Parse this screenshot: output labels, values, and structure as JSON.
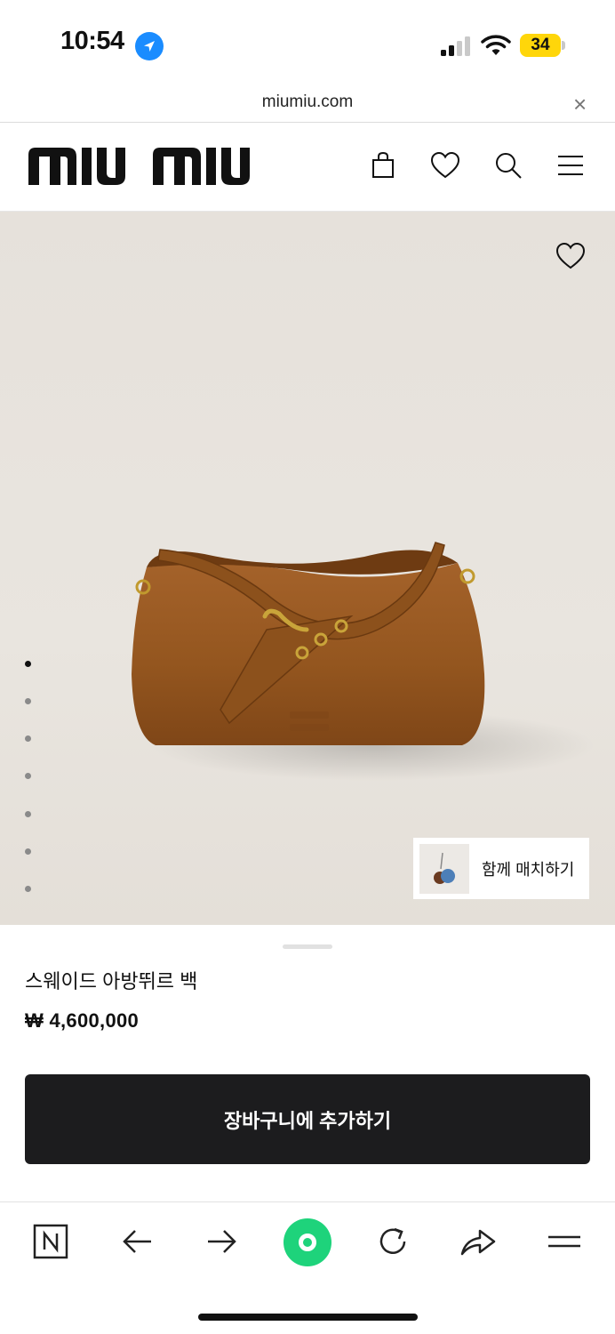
{
  "status_bar": {
    "time": "10:54",
    "battery": "34"
  },
  "browser": {
    "url": "miumiu.com",
    "close_glyph": "×"
  },
  "header": {
    "brand": "miu miu",
    "icons": [
      "shopping-bag-icon",
      "heart-icon",
      "search-icon",
      "menu-icon"
    ]
  },
  "hero": {
    "slides_total": 7,
    "active_slide": 1,
    "match_label": "함께 매치하기"
  },
  "product": {
    "name": "스웨이드 아방뛰르 백",
    "price": "₩ 4,600,000",
    "add_to_cart_label": "장바구니에 추가하기"
  },
  "colors": {
    "button_bg": "#1c1c1e",
    "accent_green": "#1ed37b",
    "location_blue": "#1a8cff",
    "battery_yellow": "#ffd60a"
  },
  "bottom_toolbar": {
    "items": [
      "naver-icon",
      "back-arrow-icon",
      "forward-arrow-icon",
      "green-dot-icon",
      "reload-icon",
      "share-icon",
      "hamburger-menu-icon"
    ]
  }
}
